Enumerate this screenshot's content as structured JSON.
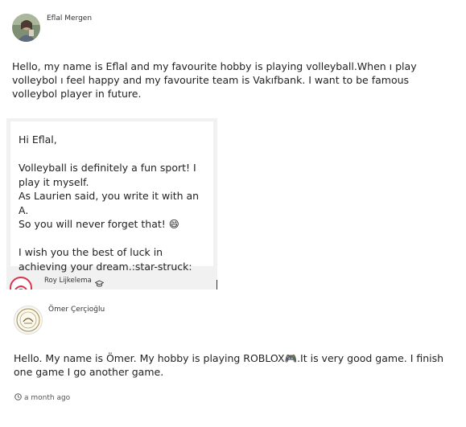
{
  "post1": {
    "author": "Eflal Mergen",
    "body": "Hello, my name is Eflal and my favourite hobby is playing volleyball.When ı play volleybol ı feel happy and my favourite team is Vakıfbank. I want to be famous volleybol player in future.",
    "avatar_icon": "user-photo-icon"
  },
  "reply": {
    "lines": [
      "Hi Eflal,",
      "",
      "Volleyball is definitely a fun sport! I play it myself.",
      "As Laurien said, you write it with an A.",
      "So you will never forget that! 😄",
      "",
      "I wish you the best of luck in achieving your dream.:star-struck:"
    ],
    "author": "Roy Lijkelema",
    "author_badge_icon": "graduation-cap-icon",
    "avatar_icon": "logo-icon"
  },
  "post2": {
    "author": "Ömer Çerçioğlu",
    "body": "Hello. My name is Ömer. My hobby is playing ROBLOX🎮.It is very good game. I finish one game I go another game.",
    "timestamp": "a month ago",
    "avatar_icon": "seal-logo-icon"
  },
  "colors": {
    "reply_bg": "#f1f1f1",
    "logo_red": "#d9344a"
  }
}
